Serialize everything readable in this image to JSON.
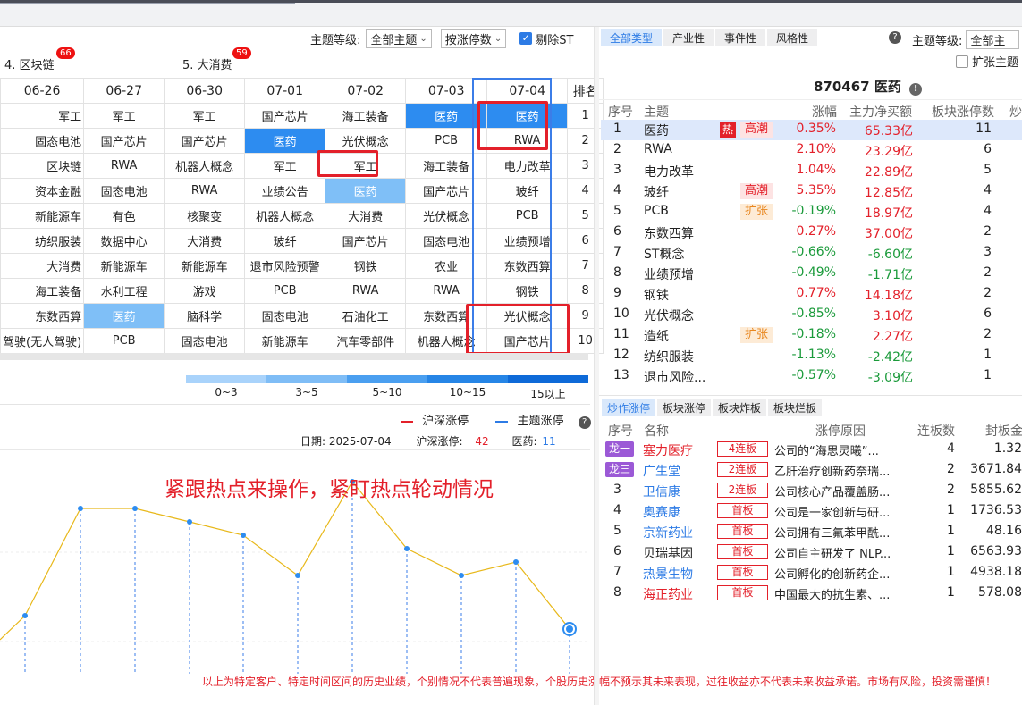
{
  "left": {
    "theme_level_label": "主题等级:",
    "theme_level_value": "全部主题",
    "sort_value": "按涨停数",
    "exclude_st_label": "剔除ST",
    "groups": [
      {
        "label": "4. 区块链",
        "count": "66"
      },
      {
        "label": "5. 大消费",
        "count": "59"
      }
    ],
    "grid_headers": [
      "06-26",
      "06-27",
      "06-30",
      "07-01",
      "07-02",
      "07-03",
      "07-04",
      "排名"
    ],
    "grid_rows": [
      [
        "军工",
        "军工",
        "军工",
        "国产芯片",
        "海工装备",
        "医药",
        "医药",
        "1"
      ],
      [
        "固态电池",
        "国产芯片",
        "国产芯片",
        "医药",
        "光伏概念",
        "PCB",
        "RWA",
        "2"
      ],
      [
        "区块链",
        "RWA",
        "机器人概念",
        "军工",
        "军工",
        "海工装备",
        "电力改革",
        "3"
      ],
      [
        "资本金融",
        "固态电池",
        "RWA",
        "业绩公告",
        "医药",
        "国产芯片",
        "玻纤",
        "4"
      ],
      [
        "新能源车",
        "有色",
        "核聚变",
        "机器人概念",
        "大消费",
        "光伏概念",
        "PCB",
        "5"
      ],
      [
        "纺织服装",
        "数据中心",
        "大消费",
        "玻纤",
        "国产芯片",
        "固态电池",
        "业绩预增",
        "6"
      ],
      [
        "大消费",
        "新能源车",
        "新能源车",
        "退市风险预警",
        "钢铁",
        "农业",
        "东数西算",
        "7"
      ],
      [
        "海工装备",
        "水利工程",
        "游戏",
        "PCB",
        "RWA",
        "RWA",
        "钢铁",
        "8"
      ],
      [
        "东数西算",
        "医药",
        "脑科学",
        "固态电池",
        "石油化工",
        "东数西算",
        "光伏概念",
        "9"
      ],
      [
        "驾驶(无人驾驶)",
        "PCB",
        "固态电池",
        "新能源车",
        "汽车零部件",
        "机器人概念",
        "国产芯片",
        "10"
      ]
    ],
    "legend": [
      "0~3",
      "3~5",
      "5~10",
      "10~15",
      "15以上"
    ],
    "legend_colors": [
      "#a9d3fb",
      "#7fbdf6",
      "#4a9ff0",
      "#2685e6",
      "#0e6ad8"
    ]
  },
  "chart_data": {
    "type": "line",
    "series": [
      {
        "name": "沪深涨停",
        "values": []
      },
      {
        "name": "主题涨停",
        "values": [
          3,
          11,
          11,
          10,
          9,
          6,
          13,
          8,
          6,
          7,
          2
        ]
      }
    ],
    "x": [
      "",
      "",
      "",
      "",
      "",
      "",
      "",
      "",
      "",
      "",
      ""
    ],
    "info": {
      "date_label": "日期:",
      "date": "2025-07-04",
      "hs_label": "沪深涨停:",
      "hs_value": "42",
      "theme_label": "医药:",
      "theme_value": "11"
    },
    "annotation": "紧跟热点来操作，紧盯热点轮动情况",
    "colors": {
      "hs": "#e3202a",
      "theme": "#e8b81a"
    }
  },
  "disclaimer": "以上为特定客户、特定时间区间的历史业绩，个别情况不代表普遍现象，个股历史涨幅不预示其未来表现，过往收益亦不代表未来收益承诺。市场有风险，投资需谨慎！",
  "right": {
    "tabs": [
      "全部类型",
      "产业性",
      "事件性",
      "风格性"
    ],
    "theme_level_label": "主题等级:",
    "theme_level_value": "全部主",
    "expand_label": "扩张主题",
    "title": "870467 医药",
    "headers": [
      "序号",
      "主题",
      "涨幅",
      "主力净买额",
      "板块涨停数",
      "炒"
    ],
    "themes": [
      {
        "no": "1",
        "name": "医药",
        "hot": "热",
        "tag": "高潮",
        "tag_type": "gc",
        "chg": "0.35%",
        "up": true,
        "net": "65.33亿",
        "net_up": true,
        "limit": "11"
      },
      {
        "no": "2",
        "name": "RWA",
        "hot": "",
        "tag": "",
        "tag_type": "",
        "chg": "2.10%",
        "up": true,
        "net": "23.29亿",
        "net_up": true,
        "limit": "6"
      },
      {
        "no": "3",
        "name": "电力改革",
        "hot": "",
        "tag": "",
        "tag_type": "",
        "chg": "1.04%",
        "up": true,
        "net": "22.89亿",
        "net_up": true,
        "limit": "5"
      },
      {
        "no": "4",
        "name": "玻纤",
        "hot": "",
        "tag": "高潮",
        "tag_type": "gc",
        "chg": "5.35%",
        "up": true,
        "net": "12.85亿",
        "net_up": true,
        "limit": "4"
      },
      {
        "no": "5",
        "name": "PCB",
        "hot": "",
        "tag": "扩张",
        "tag_type": "kz",
        "chg": "-0.19%",
        "up": false,
        "net": "18.97亿",
        "net_up": true,
        "limit": "4"
      },
      {
        "no": "6",
        "name": "东数西算",
        "hot": "",
        "tag": "",
        "tag_type": "",
        "chg": "0.27%",
        "up": true,
        "net": "37.00亿",
        "net_up": true,
        "limit": "2"
      },
      {
        "no": "7",
        "name": "ST概念",
        "hot": "",
        "tag": "",
        "tag_type": "",
        "chg": "-0.66%",
        "up": false,
        "net": "-6.60亿",
        "net_up": false,
        "limit": "3"
      },
      {
        "no": "8",
        "name": "业绩预增",
        "hot": "",
        "tag": "",
        "tag_type": "",
        "chg": "-0.49%",
        "up": false,
        "net": "-1.71亿",
        "net_up": false,
        "limit": "2"
      },
      {
        "no": "9",
        "name": "钢铁",
        "hot": "",
        "tag": "",
        "tag_type": "",
        "chg": "0.77%",
        "up": true,
        "net": "14.18亿",
        "net_up": true,
        "limit": "2"
      },
      {
        "no": "10",
        "name": "光伏概念",
        "hot": "",
        "tag": "",
        "tag_type": "",
        "chg": "-0.85%",
        "up": false,
        "net": "3.10亿",
        "net_up": true,
        "limit": "6"
      },
      {
        "no": "11",
        "name": "造纸",
        "hot": "",
        "tag": "扩张",
        "tag_type": "kz",
        "chg": "-0.18%",
        "up": false,
        "net": "2.27亿",
        "net_up": true,
        "limit": "2"
      },
      {
        "no": "12",
        "name": "纺织服装",
        "hot": "",
        "tag": "",
        "tag_type": "",
        "chg": "-1.13%",
        "up": false,
        "net": "-2.42亿",
        "net_up": false,
        "limit": "1"
      },
      {
        "no": "13",
        "name": "退市风险...",
        "hot": "",
        "tag": "",
        "tag_type": "",
        "chg": "-0.57%",
        "up": false,
        "net": "-3.09亿",
        "net_up": false,
        "limit": "1"
      }
    ],
    "stock_tabs": [
      "炒作涨停",
      "板块涨停",
      "板块炸板",
      "板块烂板"
    ],
    "stock_headers": [
      "序号",
      "名称",
      "涨停原因",
      "连板数",
      "封板金"
    ],
    "stocks": [
      {
        "no": "龙一",
        "rank_tag": true,
        "name": "塞力医疗",
        "color": "red",
        "board": "4连板",
        "reason": "公司的“海思灵曦”...",
        "days": "4",
        "amt": "1.32"
      },
      {
        "no": "龙三",
        "rank_tag": true,
        "name": "广生堂",
        "color": "blue",
        "board": "2连板",
        "reason": "乙肝治疗创新药奈瑞...",
        "days": "2",
        "amt": "3671.84"
      },
      {
        "no": "3",
        "rank_tag": false,
        "name": "卫信康",
        "color": "blue",
        "board": "2连板",
        "reason": "公司核心产品覆盖肠...",
        "days": "2",
        "amt": "5855.62"
      },
      {
        "no": "4",
        "rank_tag": false,
        "name": "奥赛康",
        "color": "blue",
        "board": "首板",
        "reason": "公司是一家创新与研...",
        "days": "1",
        "amt": "1736.53"
      },
      {
        "no": "5",
        "rank_tag": false,
        "name": "京新药业",
        "color": "blue",
        "board": "首板",
        "reason": "公司拥有三氟苯甲酰...",
        "days": "1",
        "amt": "48.16"
      },
      {
        "no": "6",
        "rank_tag": false,
        "name": "贝瑞基因",
        "color": "dark",
        "board": "首板",
        "reason": "公司自主研发了 NLP...",
        "days": "1",
        "amt": "6563.93"
      },
      {
        "no": "7",
        "rank_tag": false,
        "name": "热景生物",
        "color": "blue",
        "board": "首板",
        "reason": "公司孵化的创新药企...",
        "days": "1",
        "amt": "4938.18"
      },
      {
        "no": "8",
        "rank_tag": false,
        "name": "海正药业",
        "color": "red",
        "board": "首板",
        "reason": "中国最大的抗生素、...",
        "days": "1",
        "amt": "578.08"
      }
    ]
  }
}
